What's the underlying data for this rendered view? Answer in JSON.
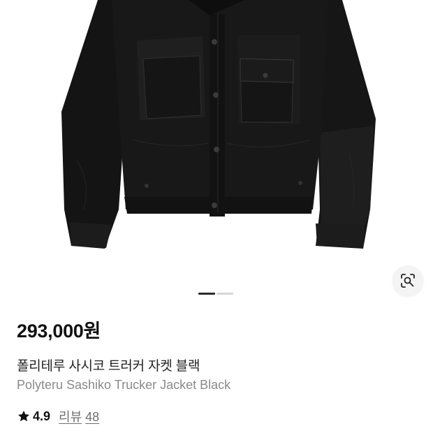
{
  "product": {
    "image_alt": "jacket-photo",
    "price": "293,000원",
    "name_ko": "폴리테루 사시코 트러커 자켓 블랙",
    "name_en": "Polyteru Sashiko Trucker Jacket Black",
    "rating": "4.9",
    "review_label": "리뷰",
    "review_count": "48"
  },
  "gallery": {
    "current_index": 1,
    "total": 2
  },
  "icons": {
    "lens": "visual-search-icon",
    "star": "star-icon"
  },
  "colors": {
    "text_primary": "#111111",
    "text_secondary": "#8a8a8a",
    "pager_active": "#2b2b2b",
    "pager_inactive": "#d7d7d7"
  }
}
